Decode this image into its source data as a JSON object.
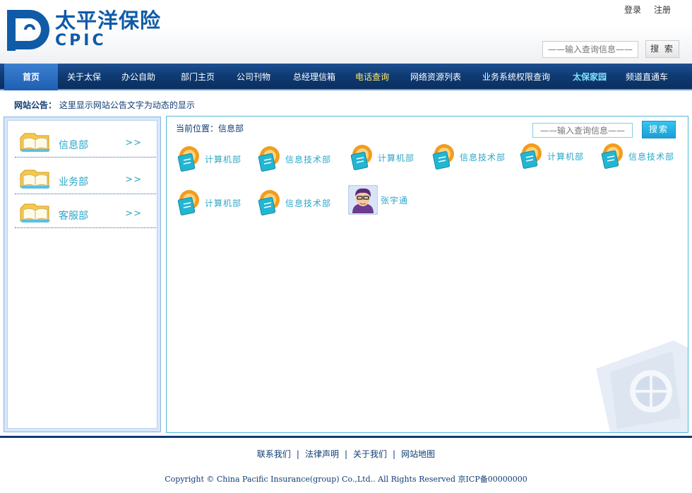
{
  "brand": {
    "name_cn": "太平洋保险",
    "name_en": "CPIC"
  },
  "top_links": {
    "login": "登录",
    "register": "注册"
  },
  "header_search": {
    "placeholder": "——输入查询信息——",
    "button": "搜 索"
  },
  "nav": {
    "items": [
      {
        "label": "首页"
      },
      {
        "label": "关于太保"
      },
      {
        "label": "办公自助"
      },
      {
        "label": "部门主页"
      },
      {
        "label": "公司刊物"
      },
      {
        "label": "总经理信箱"
      },
      {
        "label": "电话查询"
      },
      {
        "label": "网络资源列表"
      },
      {
        "label": "业务系统权限查询"
      },
      {
        "label": "太保家园"
      },
      {
        "label": "频道直通车"
      }
    ]
  },
  "notice": {
    "label": "网站公告：",
    "text": "这里显示网站公告文字为动态的显示"
  },
  "sidebar": {
    "items": [
      {
        "label": "信息部",
        "arrow": ">>"
      },
      {
        "label": "业务部",
        "arrow": ">>"
      },
      {
        "label": "客服部",
        "arrow": ">>"
      }
    ]
  },
  "main": {
    "breadcrumb": "当前位置：信息部",
    "search_placeholder": "——输入查询信息——",
    "search_button": "搜索",
    "departments": [
      {
        "label": "计算机部"
      },
      {
        "label": "信息技术部"
      },
      {
        "label": "计算机部"
      },
      {
        "label": "信息技术部"
      },
      {
        "label": "计算机部"
      },
      {
        "label": "信息技术部"
      },
      {
        "label": "计算机部"
      },
      {
        "label": "信息技术部"
      }
    ],
    "person": {
      "label": "张宇通"
    }
  },
  "footer": {
    "links": [
      "联系我们",
      "法律声明",
      "关于我们",
      "网站地图"
    ],
    "separator": "|",
    "copyright": "Copyright © China Pacific Insurance(group) Co.,Ltd.. All Rights Reserved 京ICP备00000000"
  },
  "colors": {
    "brand_blue": "#0f5ba7",
    "nav_bg": "#0e3a73",
    "accent_cyan": "#2aa7c9"
  }
}
